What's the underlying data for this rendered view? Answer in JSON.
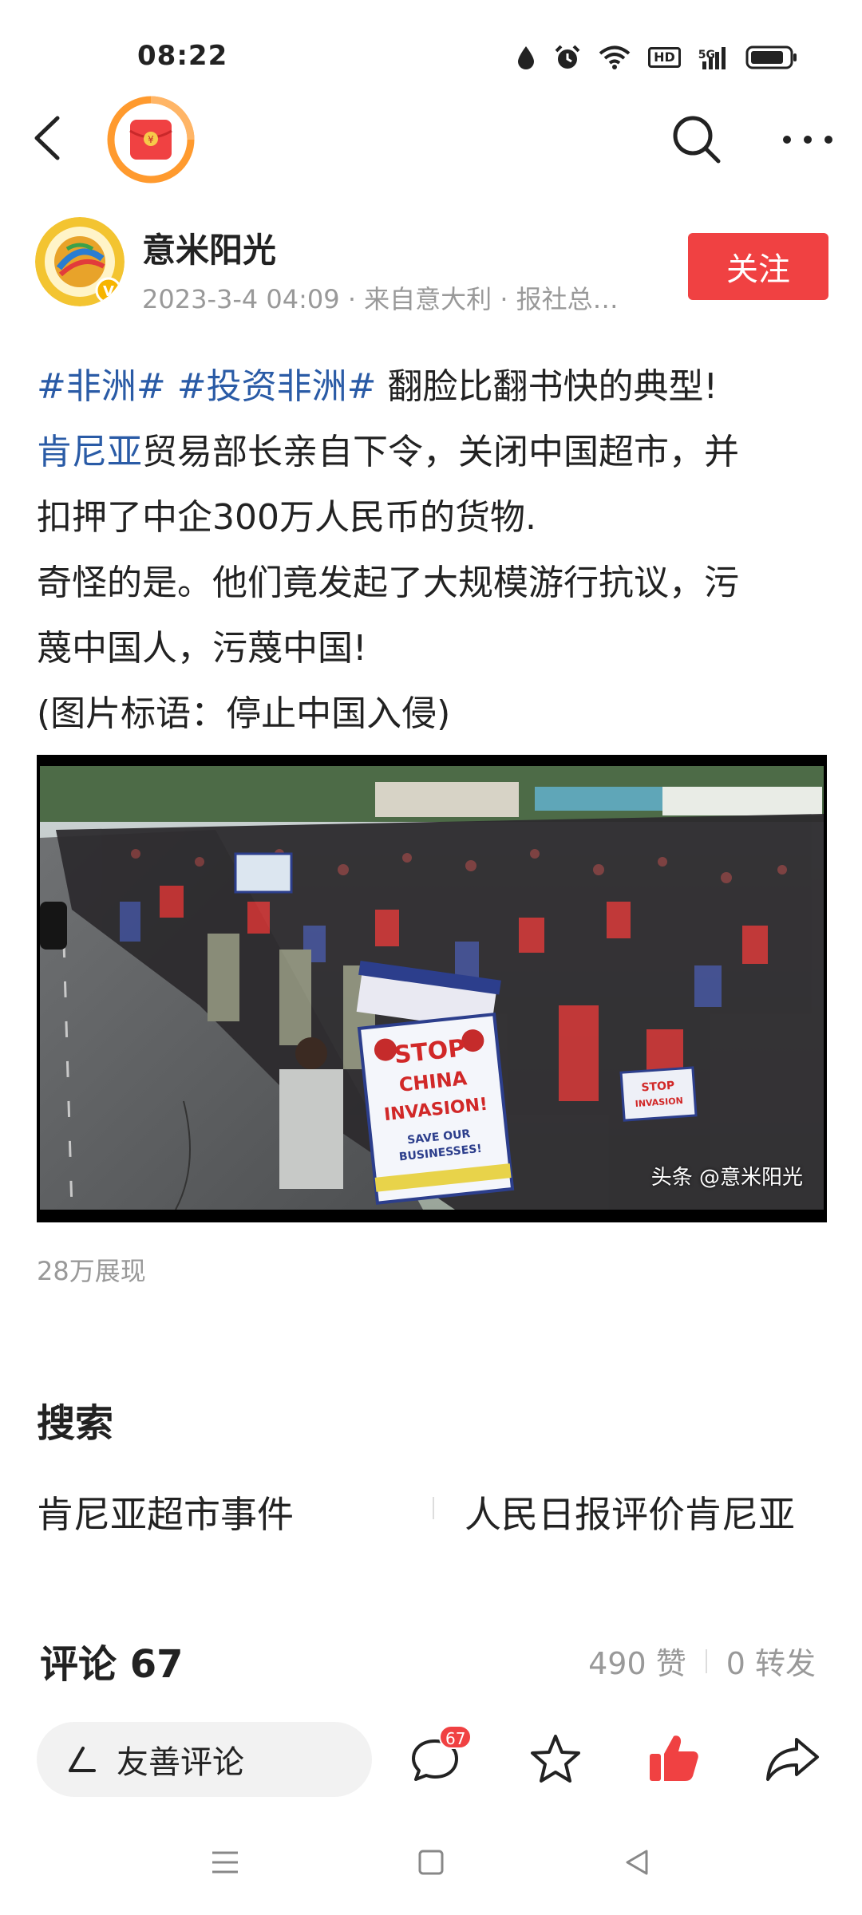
{
  "status_bar": {
    "time": "08:22",
    "hd_label": "HD",
    "signal_label": "5G",
    "icons": [
      "water-drop-icon",
      "alarm-icon",
      "wifi-icon",
      "hd-icon",
      "signal-icon",
      "battery-icon"
    ]
  },
  "nav": {
    "icons": [
      "back-arrow-icon",
      "red-packet-icon",
      "search-icon",
      "more-icon"
    ]
  },
  "author": {
    "name": "意米阳光",
    "meta": "2023-3-4 04:09 · 来自意大利 · 报社总…",
    "follow_label": "关注"
  },
  "article": {
    "line1_tags": "#非洲# #投资非洲#",
    "line1_text": " 翻脸比翻书快的典型!",
    "line2_link": "肯尼亚",
    "line2_text": "贸易部长亲自下令，关闭中国超市，并",
    "line3": "扣押了中企300万人民币的货物.",
    "line4": "奇怪的是。他们竟发起了大规模游行抗议，污",
    "line5": "蔑中国人，污蔑中国!",
    "line6": "(图片标语：停止中国入侵)"
  },
  "photo": {
    "watermark": "头条 @意米阳光",
    "sign_main": "STOP CHINA INVASION! SAVE OUR BUSINESSES!"
  },
  "views_text": "28万展现",
  "search": {
    "title": "搜索",
    "items": [
      "肯尼亚超市事件",
      "人民日报评价肯尼亚"
    ]
  },
  "comments": {
    "title": "评论 67",
    "likes": "490 赞",
    "shares": "0 转发"
  },
  "bottom_bar": {
    "comment_placeholder": "友善评论",
    "comment_badge": "67",
    "icons": [
      "pen-icon",
      "comment-icon",
      "star-icon",
      "thumbs-up-icon",
      "share-icon"
    ]
  },
  "colors": {
    "accent_red": "#f04142",
    "link_blue": "#2a5ba6",
    "muted_gray": "#999999"
  }
}
